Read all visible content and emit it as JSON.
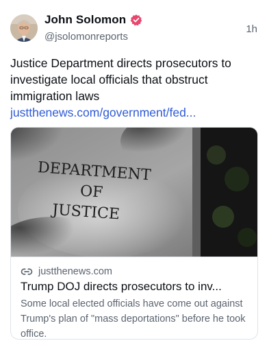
{
  "author": {
    "display_name": "John Solomon",
    "handle": "@jsolomonreports",
    "timestamp": "1h",
    "verified_badge_color": "#e8476f"
  },
  "post": {
    "text": "Justice Department directs prosecutors to investigate local officials that obstruct immigration laws ",
    "link_text": "justthenews.com/government/fed..."
  },
  "link_card": {
    "image_sign_text": [
      "DEPARTMENT",
      "OF",
      "JUSTICE"
    ],
    "domain": "justthenews.com",
    "title": "Trump DOJ directs prosecutors to inv...",
    "description": "Some local elected officials have come out against Trump's plan of \"mass deportations\" before he took office."
  },
  "colors": {
    "link": "#2f5bd6",
    "secondary_text": "#5b6470",
    "primary_text": "#0b0f14"
  }
}
